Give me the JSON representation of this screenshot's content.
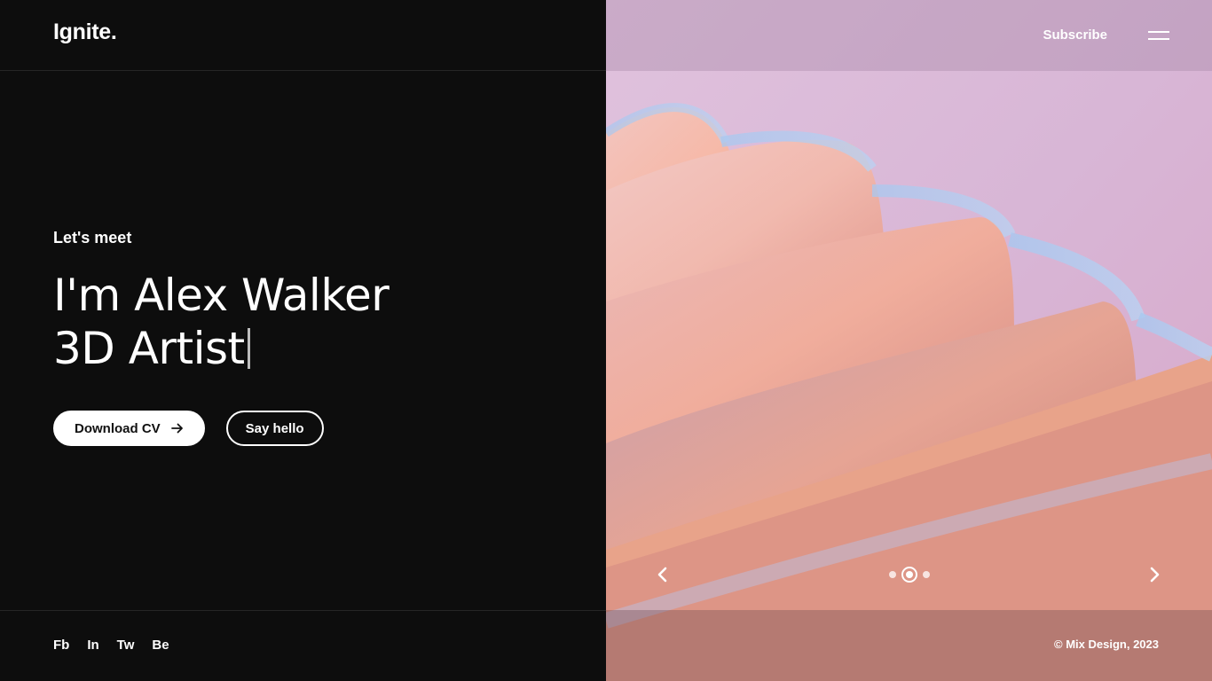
{
  "brand": {
    "logo": "Ignite."
  },
  "header": {
    "subscribe_label": "Subscribe",
    "menu_icon": "hamburger-icon"
  },
  "hero": {
    "eyebrow": "Let's meet",
    "name_line": "I'm Alex Walker",
    "role_line": "3D Artist",
    "download_label": "Download CV",
    "hello_label": "Say hello"
  },
  "social": [
    "Fb",
    "In",
    "Tw",
    "Be"
  ],
  "slider": {
    "prev_icon": "chevron-left-icon",
    "next_icon": "chevron-right-icon",
    "dots_count": 3,
    "active_index": 1
  },
  "footer": {
    "copyright": "© Mix Design, 2023"
  },
  "colors": {
    "left_bg": "#0d0d0d",
    "accent": "#ffffff",
    "image_tone": "#dcbcd8"
  }
}
